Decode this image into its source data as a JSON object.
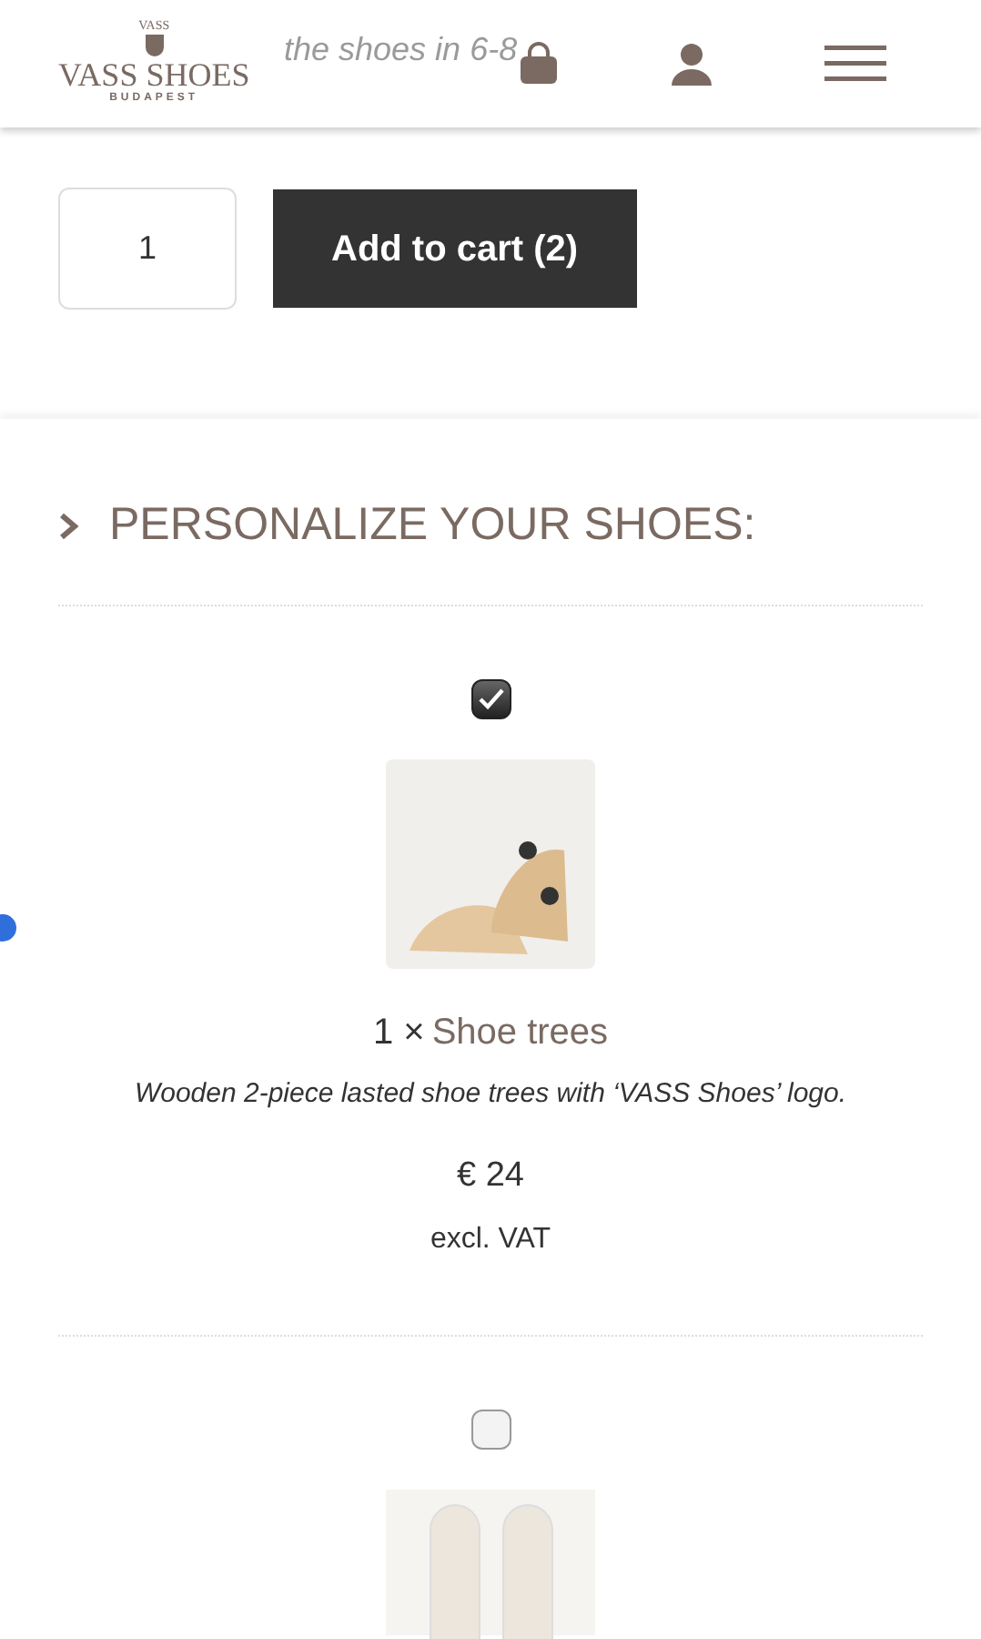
{
  "background_text": "the shoes in 6-8",
  "header": {
    "logo": {
      "crest": "VASS",
      "name": "VASS SHOES",
      "city": "BUDAPEST"
    }
  },
  "purchase": {
    "quantity": "1",
    "button": "Add to cart (2)"
  },
  "personalize": {
    "title": "PERSONALIZE YOUR SHOES:",
    "expanded": false,
    "items": [
      {
        "checked": true,
        "kind": "shoe-trees",
        "quantity": "1 ×",
        "name": "Shoe trees",
        "description": "Wooden 2-piece lasted shoe trees with ‘VASS Shoes’ logo.",
        "price": "€ 24",
        "tax_note": "excl. VAT"
      },
      {
        "checked": false,
        "kind": "insoles"
      }
    ]
  }
}
